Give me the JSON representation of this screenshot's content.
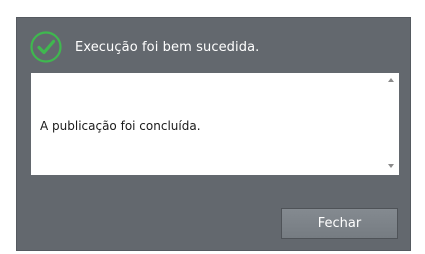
{
  "dialog": {
    "title": "Execução foi bem sucedida.",
    "status_icon": "check-circle-icon",
    "message": "A publicação foi concluída.",
    "close_label": "Fechar"
  },
  "colors": {
    "dialog_background": "#63686e",
    "success_green": "#3fb84f",
    "button_background": "#7d8389"
  }
}
